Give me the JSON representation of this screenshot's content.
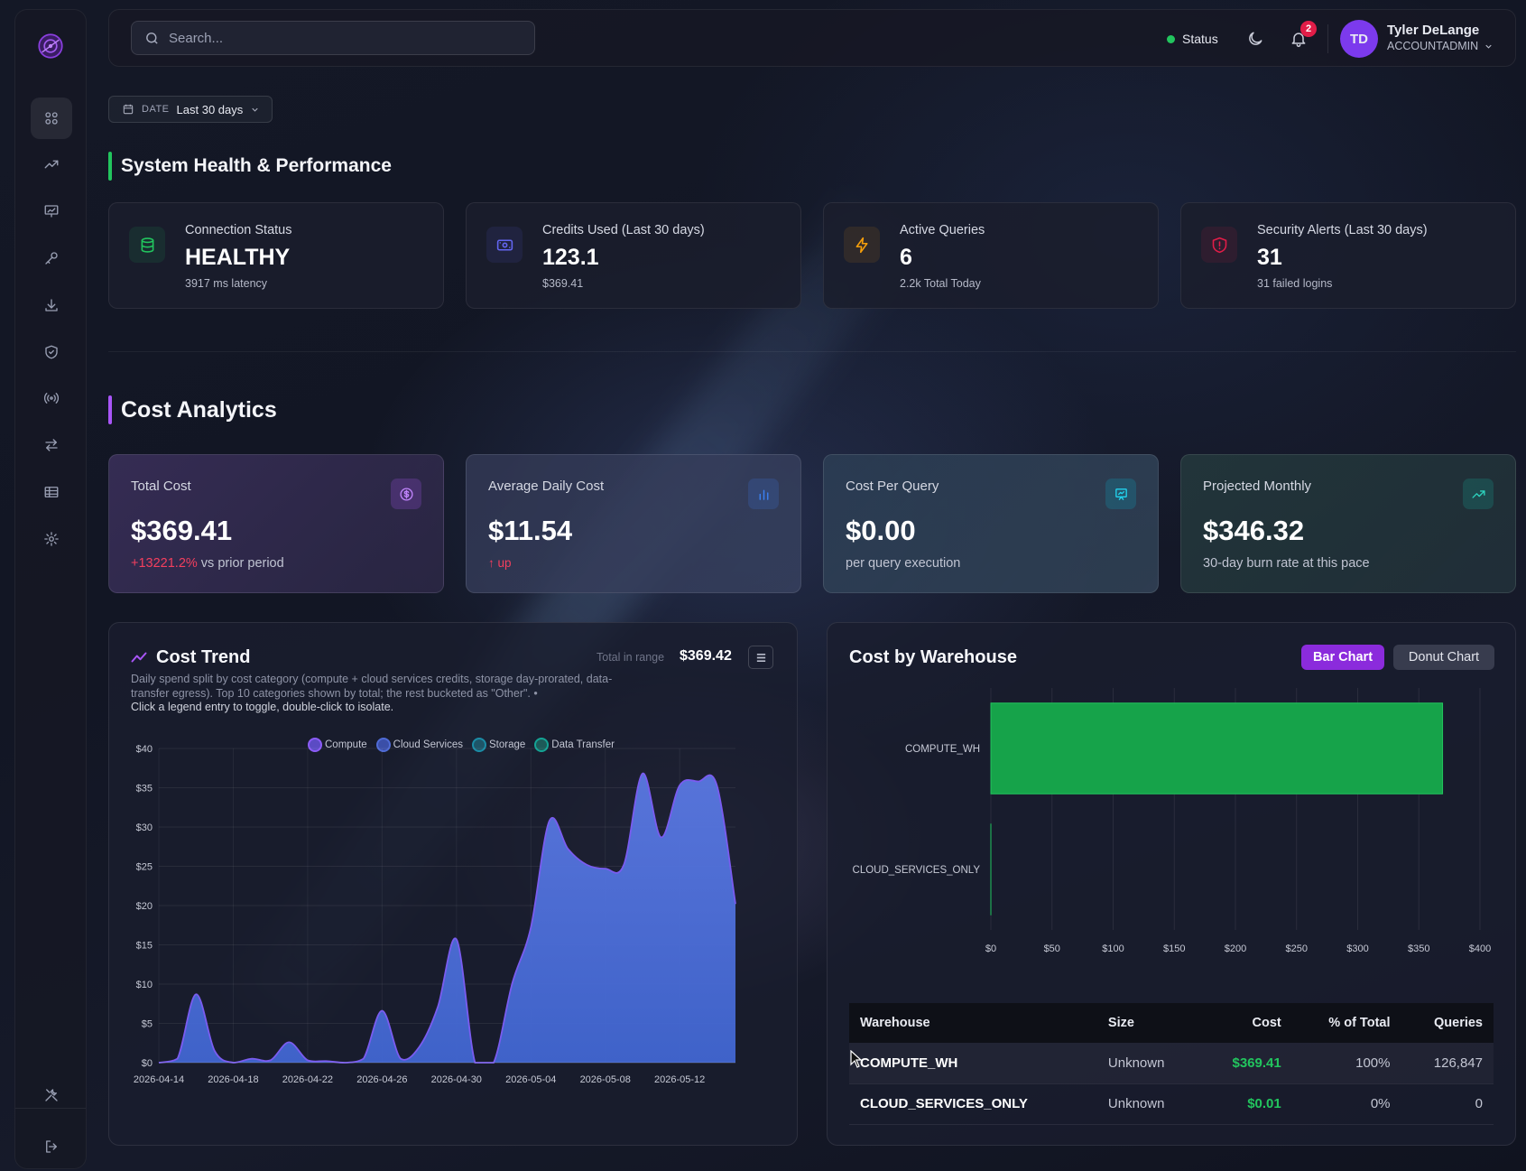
{
  "search": {
    "placeholder": "Search..."
  },
  "header": {
    "status_label": "Status",
    "notification_count": "2",
    "user_initials": "TD",
    "user_name": "Tyler DeLange",
    "user_role": "ACCOUNTADMIN"
  },
  "date_filter": {
    "label": "DATE",
    "value": "Last 30 days"
  },
  "sections": {
    "health": "System Health & Performance",
    "cost": "Cost Analytics"
  },
  "health_cards": [
    {
      "title": "Connection Status",
      "value": "HEALTHY",
      "sub": "3917 ms latency"
    },
    {
      "title": "Credits Used (Last 30 days)",
      "value": "123.1",
      "sub": "$369.41"
    },
    {
      "title": "Active Queries",
      "value": "6",
      "sub": "2.2k Total Today"
    },
    {
      "title": "Security Alerts (Last 30 days)",
      "value": "31",
      "sub": "31 failed logins"
    }
  ],
  "cost_cards": [
    {
      "title": "Total Cost",
      "value": "$369.41",
      "delta": "+13221.2%",
      "sub": " vs prior period"
    },
    {
      "title": "Average Daily Cost",
      "value": "$11.54",
      "delta": "↑ up"
    },
    {
      "title": "Cost Per Query",
      "value": "$0.00",
      "sub": "per query execution"
    },
    {
      "title": "Projected Monthly",
      "value": "$346.32",
      "sub": "30-day burn rate at this pace"
    }
  ],
  "trend_panel": {
    "title": "Cost Trend",
    "desc": "Daily spend split by cost category (compute + cloud services credits, storage day-prorated, data-transfer egress). Top 10 categories shown by total; the rest bucketed as \"Other\".  •",
    "hint": "Click a legend entry to toggle, double-click to isolate.",
    "total_label": "Total in range",
    "total_value": "$369.42"
  },
  "warehouse_panel": {
    "title": "Cost by Warehouse",
    "tab_bar": "Bar Chart",
    "tab_donut": "Donut Chart",
    "table_headers": {
      "warehouse": "Warehouse",
      "size": "Size",
      "cost": "Cost",
      "pct": "% of Total",
      "queries": "Queries"
    },
    "rows": [
      {
        "warehouse": "COMPUTE_WH",
        "size": "Unknown",
        "cost": "$369.41",
        "pct": "100%",
        "queries": "126,847"
      },
      {
        "warehouse": "CLOUD_SERVICES_ONLY",
        "size": "Unknown",
        "cost": "$0.01",
        "pct": "0%",
        "queries": "0"
      }
    ]
  },
  "colors": {
    "accent_purple": "#8b2bdc",
    "healthy_green": "#22c55e",
    "danger_red": "#e11d48",
    "area_blue": "#4a6fd8",
    "bar_green": "#16a34a"
  },
  "chart_data": [
    {
      "type": "area",
      "x": [
        "2026-04-14",
        "2026-04-15",
        "2026-04-16",
        "2026-04-17",
        "2026-04-18",
        "2026-04-19",
        "2026-04-20",
        "2026-04-21",
        "2026-04-22",
        "2026-04-23",
        "2026-04-24",
        "2026-04-25",
        "2026-04-26",
        "2026-04-27",
        "2026-04-28",
        "2026-04-29",
        "2026-04-30",
        "2026-05-01",
        "2026-05-02",
        "2026-05-03",
        "2026-05-04",
        "2026-05-05",
        "2026-05-06",
        "2026-05-07",
        "2026-05-08",
        "2026-05-09",
        "2026-05-10",
        "2026-05-11",
        "2026-05-12",
        "2026-05-13",
        "2026-05-14",
        "2026-05-15"
      ],
      "xticks": [
        "2026-04-14",
        "2026-04-18",
        "2026-04-22",
        "2026-04-26",
        "2026-04-30",
        "2026-05-04",
        "2026-05-08",
        "2026-05-12"
      ],
      "series": [
        {
          "name": "Compute",
          "values": [
            0,
            0.5,
            8.5,
            1.5,
            0,
            0.5,
            0.3,
            2.5,
            0.3,
            0.2,
            0,
            0.5,
            6.5,
            0.5,
            2,
            7,
            15.5,
            0,
            0,
            10,
            17,
            30.5,
            27,
            25,
            24.5,
            25,
            36.5,
            28.5,
            35,
            35.5,
            35,
            20
          ]
        },
        {
          "name": "Cloud Services",
          "values": [
            0,
            0,
            0.2,
            0,
            0,
            0,
            0,
            0.1,
            0,
            0,
            0,
            0,
            0.1,
            0,
            0,
            0.1,
            0.2,
            0,
            0,
            0.1,
            0.2,
            0.3,
            0.2,
            0.2,
            0.2,
            0.2,
            0.3,
            0.2,
            0.3,
            0.3,
            0.3,
            0.2
          ]
        },
        {
          "name": "Storage",
          "values": [
            0,
            0,
            0,
            0,
            0,
            0,
            0,
            0,
            0,
            0,
            0,
            0,
            0,
            0,
            0,
            0,
            0,
            0,
            0,
            0,
            0,
            0,
            0,
            0,
            0,
            0,
            0,
            0,
            0,
            0,
            0,
            0
          ]
        },
        {
          "name": "Data Transfer",
          "values": [
            0,
            0,
            0,
            0,
            0,
            0,
            0,
            0,
            0,
            0,
            0,
            0,
            0,
            0,
            0,
            0,
            0,
            0,
            0,
            0,
            0,
            0,
            0,
            0,
            0,
            0,
            0,
            0,
            0,
            0,
            0,
            0
          ]
        }
      ],
      "yticks": [
        "$0",
        "$5",
        "$10",
        "$15",
        "$20",
        "$25",
        "$30",
        "$35",
        "$40"
      ],
      "ylim": [
        0,
        40
      ],
      "legend": "top",
      "grid": true
    },
    {
      "type": "bar",
      "orientation": "horizontal",
      "categories": [
        "COMPUTE_WH",
        "CLOUD_SERVICES_ONLY"
      ],
      "values": [
        369.41,
        0.01
      ],
      "xticks": [
        "$0",
        "$50",
        "$100",
        "$150",
        "$200",
        "$250",
        "$300",
        "$350",
        "$400"
      ],
      "xlim": [
        0,
        400
      ],
      "grid": true
    }
  ]
}
